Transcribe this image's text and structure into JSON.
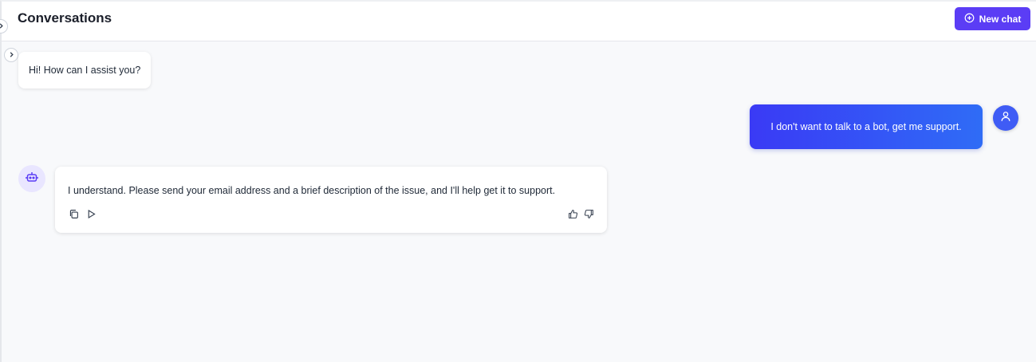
{
  "header": {
    "title": "Conversations",
    "new_chat_label": "New chat"
  },
  "messages": [
    {
      "role": "bot",
      "text": "Hi! How can I assist you?"
    },
    {
      "role": "user",
      "text": "I don't want to talk to a bot, get me support."
    },
    {
      "role": "bot",
      "text": "I understand. Please send your email address and a brief description of the issue, and I'll help get it to support."
    }
  ],
  "icons": {
    "new_chat": "plus-circle-icon",
    "sidebar_toggle": "chevron-right-icon",
    "user_avatar": "user-icon",
    "bot_avatar": "bot-icon",
    "copy": "copy-icon",
    "play": "play-icon",
    "thumbs_up": "thumbs-up-icon",
    "thumbs_down": "thumbs-down-icon"
  },
  "colors": {
    "accent": "#5b3df5",
    "user_bubble_start": "#3a3af5",
    "user_bubble_end": "#2f6cf6",
    "user_avatar": "#3f5cf5",
    "bot_avatar_bg": "#e9e6ff"
  }
}
